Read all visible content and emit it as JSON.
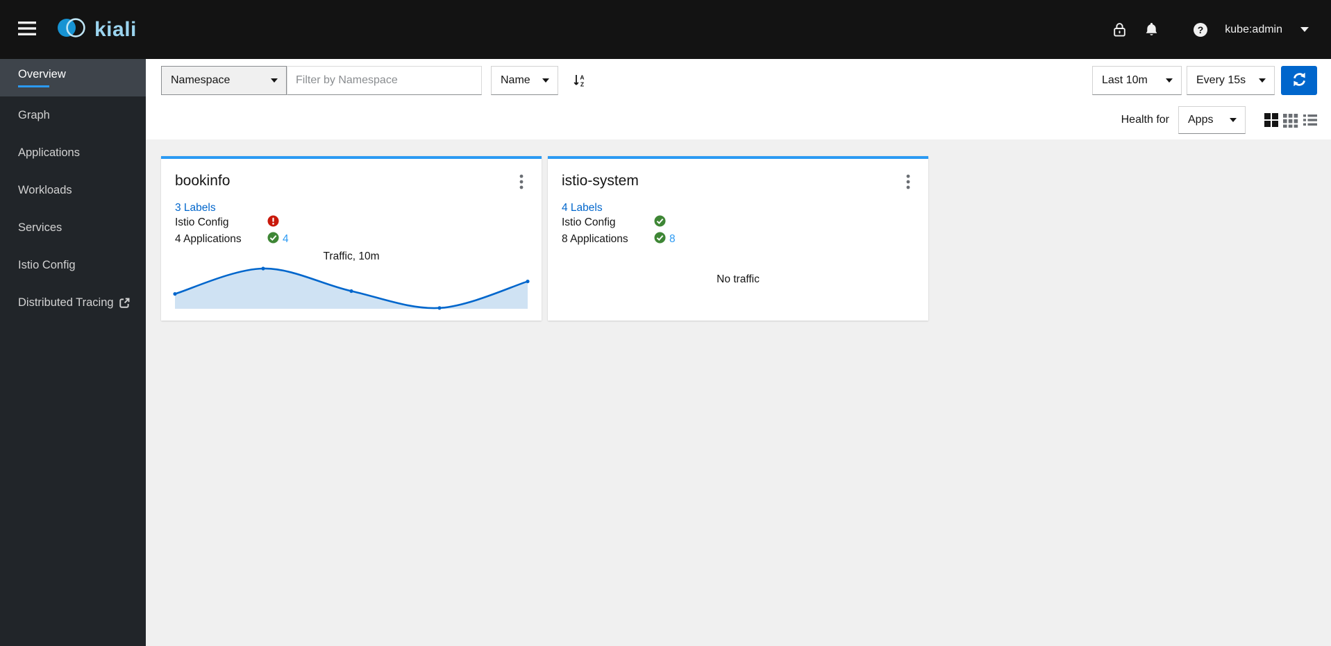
{
  "masthead": {
    "brand": "kiali",
    "username": "kube:admin"
  },
  "sidebar": {
    "items": [
      {
        "label": "Overview",
        "active": true
      },
      {
        "label": "Graph"
      },
      {
        "label": "Applications"
      },
      {
        "label": "Workloads"
      },
      {
        "label": "Services"
      },
      {
        "label": "Istio Config"
      },
      {
        "label": "Distributed Tracing",
        "external": true
      }
    ]
  },
  "toolbar": {
    "namespace_label": "Namespace",
    "filter_placeholder": "Filter by Namespace",
    "filter_value": "",
    "sort_field": "Name",
    "duration": "Last 10m",
    "refresh_interval": "Every 15s",
    "health_for_label": "Health for",
    "health_for_value": "Apps"
  },
  "cards": [
    {
      "title": "bookinfo",
      "labels_link": "3 Labels",
      "istio_config_label": "Istio Config",
      "istio_config_status": "error",
      "apps_label": "4 Applications",
      "apps_status": "ok",
      "apps_count": "4",
      "traffic_title": "Traffic, 10m"
    },
    {
      "title": "istio-system",
      "labels_link": "4 Labels",
      "istio_config_label": "Istio Config",
      "istio_config_status": "ok",
      "apps_label": "8 Applications",
      "apps_status": "ok",
      "apps_count": "8",
      "no_traffic_text": "No traffic"
    }
  ],
  "chart_data": {
    "type": "area",
    "title": "Traffic, 10m",
    "x_minutes": [
      0,
      2.5,
      5,
      7.5,
      10
    ],
    "values_normalized": [
      0.37,
      1.0,
      0.44,
      0.02,
      0.68
    ],
    "xlabel": "",
    "ylabel": "",
    "axes_shown": false,
    "line_color": "#0066cc",
    "fill_color": "#cfe2f3"
  },
  "icons": {
    "menu": "hamburger",
    "security": "lock",
    "notifications": "bell",
    "help": "question-circle",
    "user": "caret-down",
    "sort": "sort-alpha-down",
    "refresh": "sync",
    "card_menu": "kebab-vertical",
    "tracing_link": "external-link",
    "view_modes": [
      "grid-compact",
      "grid-dense",
      "list"
    ]
  },
  "colors": {
    "masthead_bg": "#131313",
    "sidebar_bg": "#212529",
    "card_accent": "#2b9af3",
    "link": "#0066cc",
    "count_link": "#2b9af3",
    "success": "#3e8635",
    "danger": "#c9190b",
    "refresh_button": "#0066cc"
  }
}
